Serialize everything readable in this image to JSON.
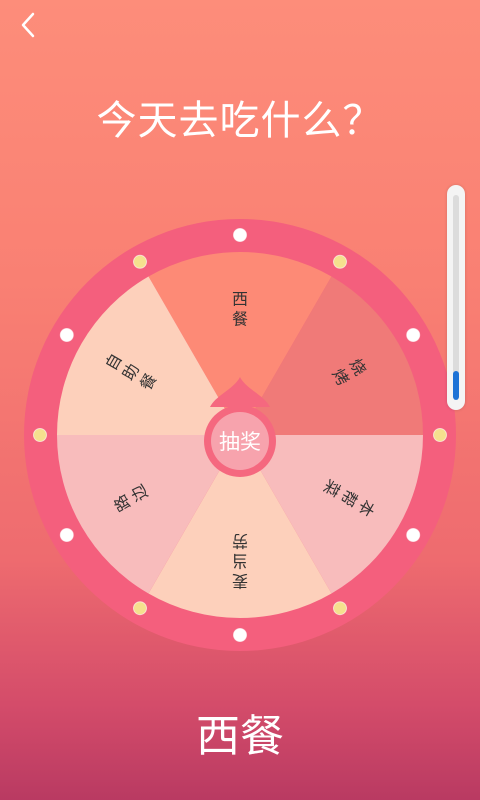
{
  "nav": {
    "back_icon": "chevron-left-icon"
  },
  "title": "今天去吃什么？",
  "wheel": {
    "segments": [
      {
        "label": "西餐",
        "color": "#fd8a76"
      },
      {
        "label": "烧烤",
        "color": "#f07a78"
      },
      {
        "label": "本帮菜",
        "color": "#f8bcbc"
      },
      {
        "label": "麦当劳",
        "color": "#fdd0bb"
      },
      {
        "label": "路边",
        "color": "#f8bcbc"
      },
      {
        "label": "自助餐",
        "color": "#fdd0bb"
      }
    ],
    "rim_color": "#f45f7d",
    "bulb_colors": [
      "#ffffff",
      "#f5e08e"
    ],
    "hub_color": "#f5687f",
    "button_label": "抽奖"
  },
  "scroll": {
    "level": 0.14
  },
  "result": "西餐"
}
